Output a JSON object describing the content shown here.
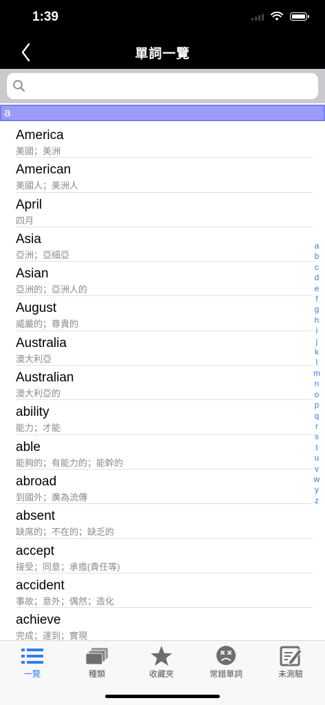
{
  "status_bar": {
    "time": "1:39"
  },
  "nav": {
    "title": "單詞一覽"
  },
  "search": {
    "placeholder": "",
    "value": ""
  },
  "section": {
    "header": "a"
  },
  "words": [
    {
      "en": "America",
      "zh": "美國；美洲"
    },
    {
      "en": "American",
      "zh": "美國人；美洲人"
    },
    {
      "en": "April",
      "zh": "四月"
    },
    {
      "en": "Asia",
      "zh": "亞洲；亞細亞"
    },
    {
      "en": "Asian",
      "zh": "亞洲的；亞洲人的"
    },
    {
      "en": "August",
      "zh": "威嚴的；尊貴的"
    },
    {
      "en": "Australia",
      "zh": "澳大利亞"
    },
    {
      "en": "Australian",
      "zh": "澳大利亞的"
    },
    {
      "en": "ability",
      "zh": "能力；才能"
    },
    {
      "en": "able",
      "zh": "能夠的；有能力的；能幹的"
    },
    {
      "en": "abroad",
      "zh": "到國外；廣為流傳"
    },
    {
      "en": "absent",
      "zh": "缺席的；不在的；缺乏的"
    },
    {
      "en": "accept",
      "zh": "接受；同意；承擔(責任等)"
    },
    {
      "en": "accident",
      "zh": "事故；意外；偶然；造化"
    },
    {
      "en": "achieve",
      "zh": "完成；達到；實現"
    }
  ],
  "alpha_index": [
    "a",
    "b",
    "c",
    "d",
    "e",
    "f",
    "g",
    "h",
    "i",
    "j",
    "k",
    "l",
    "m",
    "n",
    "o",
    "p",
    "q",
    "r",
    "s",
    "t",
    "u",
    "v",
    "w",
    "y",
    "z"
  ],
  "tabs": [
    {
      "label": "一覽",
      "icon": "list-icon",
      "active": true
    },
    {
      "label": "種類",
      "icon": "cards-icon",
      "active": false
    },
    {
      "label": "收藏夾",
      "icon": "star-icon",
      "active": false
    },
    {
      "label": "常錯單詞",
      "icon": "sad-face-icon",
      "active": false
    },
    {
      "label": "未測驗",
      "icon": "edit-icon",
      "active": false
    }
  ],
  "colors": {
    "accent": "#2d7ef7",
    "section_header": "#9b9cf5",
    "inactive_icon": "#6e6e6e"
  }
}
